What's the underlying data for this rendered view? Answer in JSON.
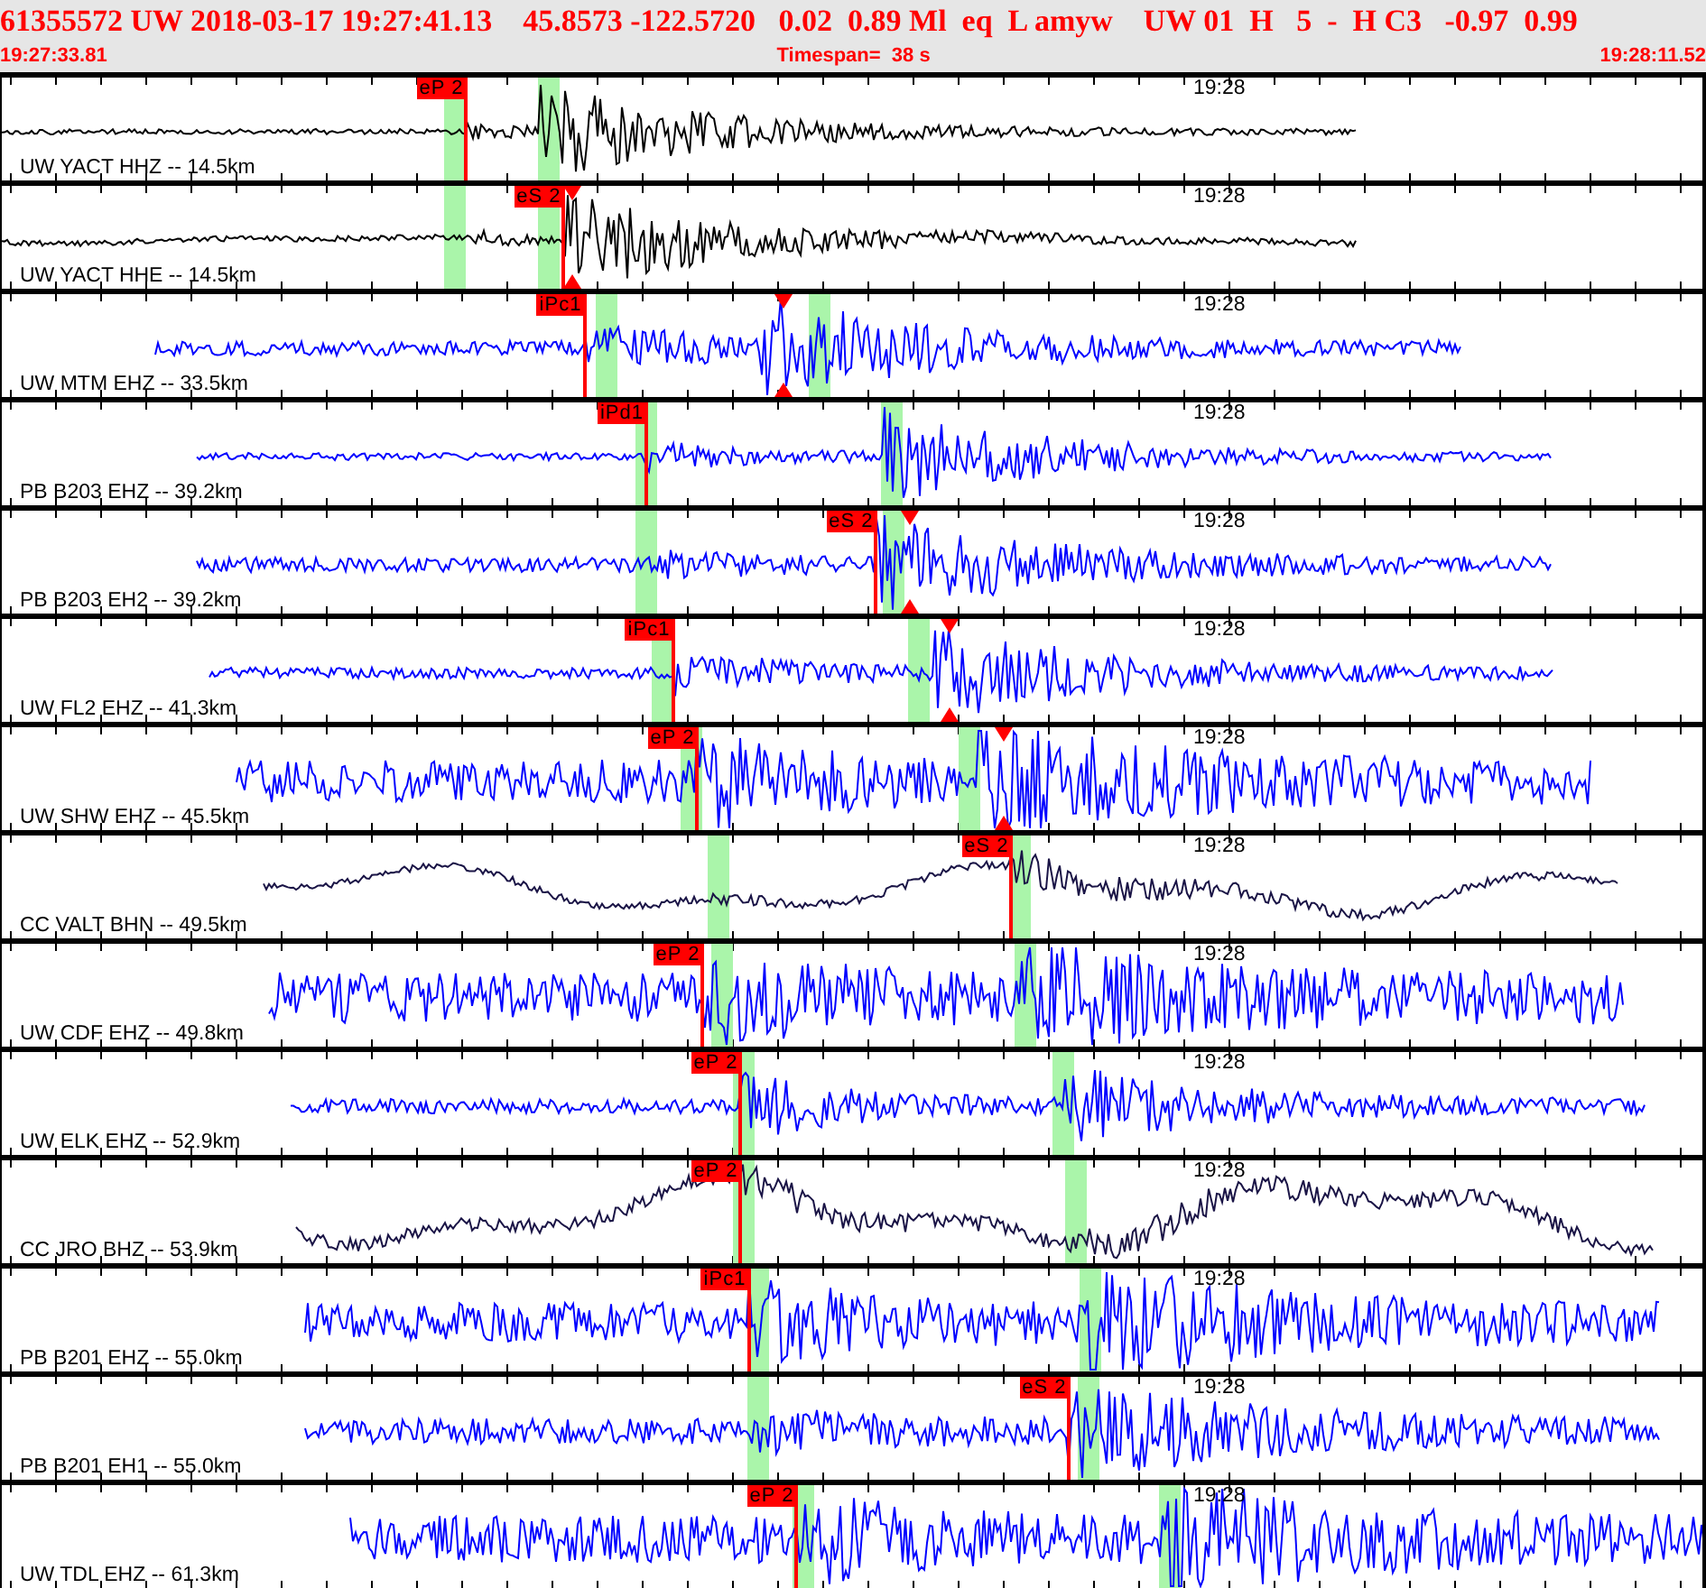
{
  "header": {
    "event_line": "61355572 UW 2018-03-17 19:27:41.13    45.8573 -122.5720   0.02  0.89 Ml  eq  L amyw    UW 01  H   5  -  H C3   -0.97  0.99",
    "start_time": "19:27:33.81",
    "timespan": "Timespan=  38 s",
    "end_time": "19:28:11.52"
  },
  "traces": [
    {
      "label": "UW YACT HHZ -- 14.5km",
      "time_label": "19:28",
      "color": "#000000",
      "picks": [
        "eP 2"
      ]
    },
    {
      "label": "UW YACT HHE -- 14.5km",
      "time_label": "19:28",
      "color": "#000000",
      "picks": [
        "eS 2"
      ]
    },
    {
      "label": "UW MTM EHZ -- 33.5km",
      "time_label": "19:28",
      "color": "#0000ff",
      "picks": [
        "iPc1"
      ]
    },
    {
      "label": "PB B203 EHZ -- 39.2km",
      "time_label": "19:28",
      "color": "#0000ff",
      "picks": [
        "iPd1"
      ]
    },
    {
      "label": "PB B203 EH2 -- 39.2km",
      "time_label": "19:28",
      "color": "#0000ff",
      "picks": [
        "eS 2"
      ]
    },
    {
      "label": "UW FL2 EHZ -- 41.3km",
      "time_label": "19:28",
      "color": "#0000ff",
      "picks": [
        "iPc1"
      ]
    },
    {
      "label": "UW SHW EHZ -- 45.5km",
      "time_label": "19:28",
      "color": "#0000ff",
      "picks": [
        "eP 2"
      ]
    },
    {
      "label": "CC VALT BHN -- 49.5km",
      "time_label": "19:28",
      "color": "#1a1446",
      "picks": [
        "eS 2"
      ]
    },
    {
      "label": "UW CDF EHZ -- 49.8km",
      "time_label": "19:28",
      "color": "#0000ff",
      "picks": [
        "eP 2"
      ]
    },
    {
      "label": "UW ELK EHZ -- 52.9km",
      "time_label": "19:28",
      "color": "#0000ff",
      "picks": [
        "eP 2"
      ]
    },
    {
      "label": "CC JRO BHZ -- 53.9km",
      "time_label": "19:28",
      "color": "#1a1446",
      "picks": [
        "eP 2"
      ]
    },
    {
      "label": "PB B201 EHZ -- 55.0km",
      "time_label": "19:28",
      "color": "#0000ff",
      "picks": [
        "iPc1"
      ]
    },
    {
      "label": "PB B201 EH1 -- 55.0km",
      "time_label": "19:28",
      "color": "#0000ff",
      "picks": [
        "eS 2"
      ]
    },
    {
      "label": "UW TDL EHZ -- 61.3km",
      "time_label": "19:28",
      "color": "#0000ff",
      "picks": [
        "eP 2"
      ]
    }
  ]
}
